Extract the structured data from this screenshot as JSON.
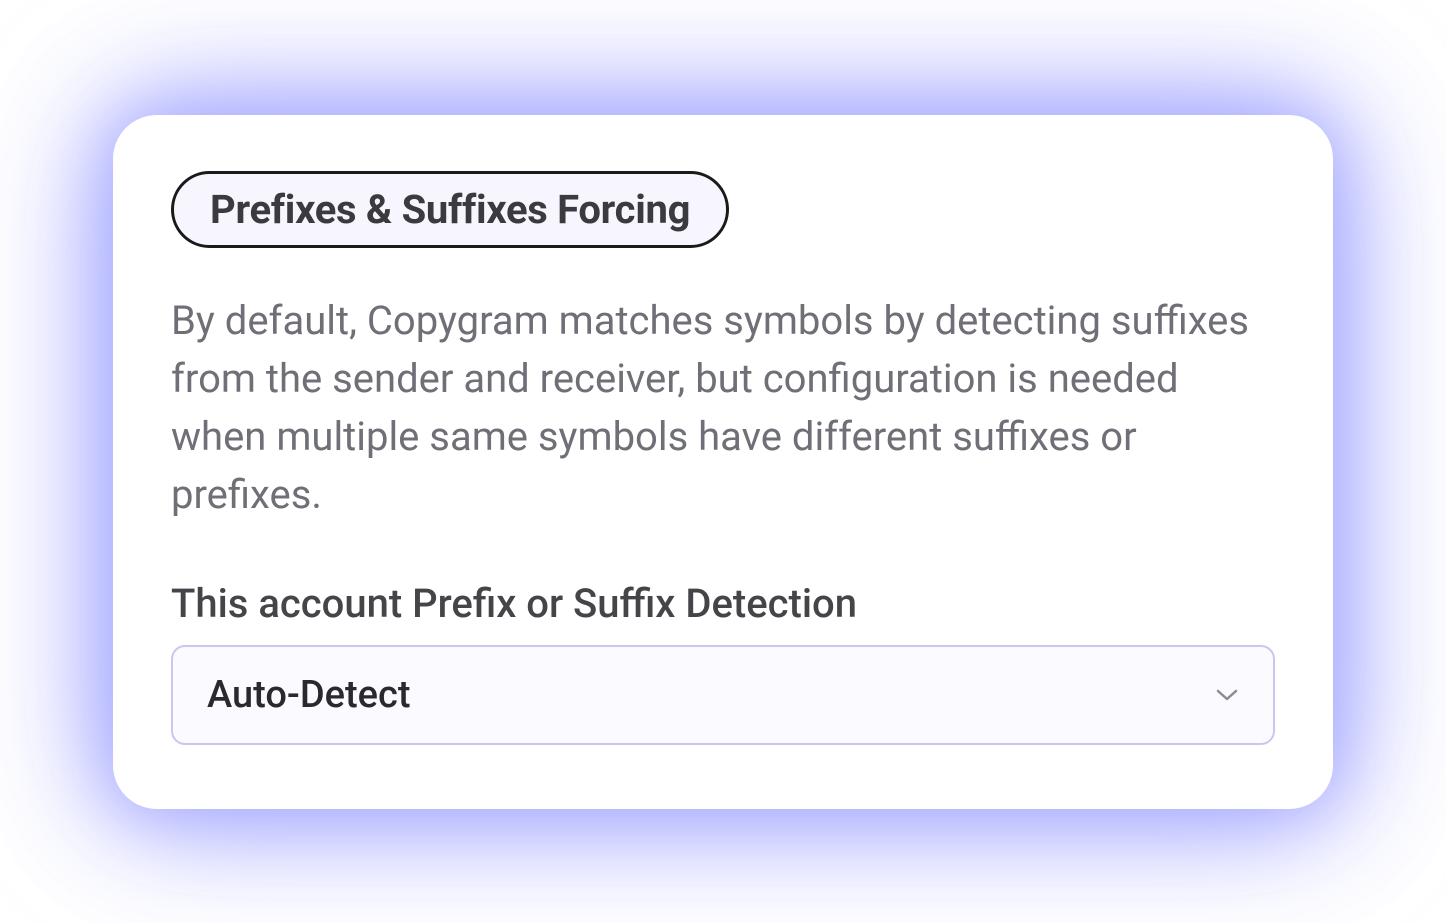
{
  "panel": {
    "title": "Prefixes & Suffixes Forcing",
    "description": "By default, Copygram matches symbols by detecting suffixes from the sender and receiver, but configuration is needed when multiple same symbols have different suffixes or prefixes.",
    "field": {
      "label": "This account Prefix or Suffix Detection",
      "selected": "Auto-Detect"
    }
  }
}
